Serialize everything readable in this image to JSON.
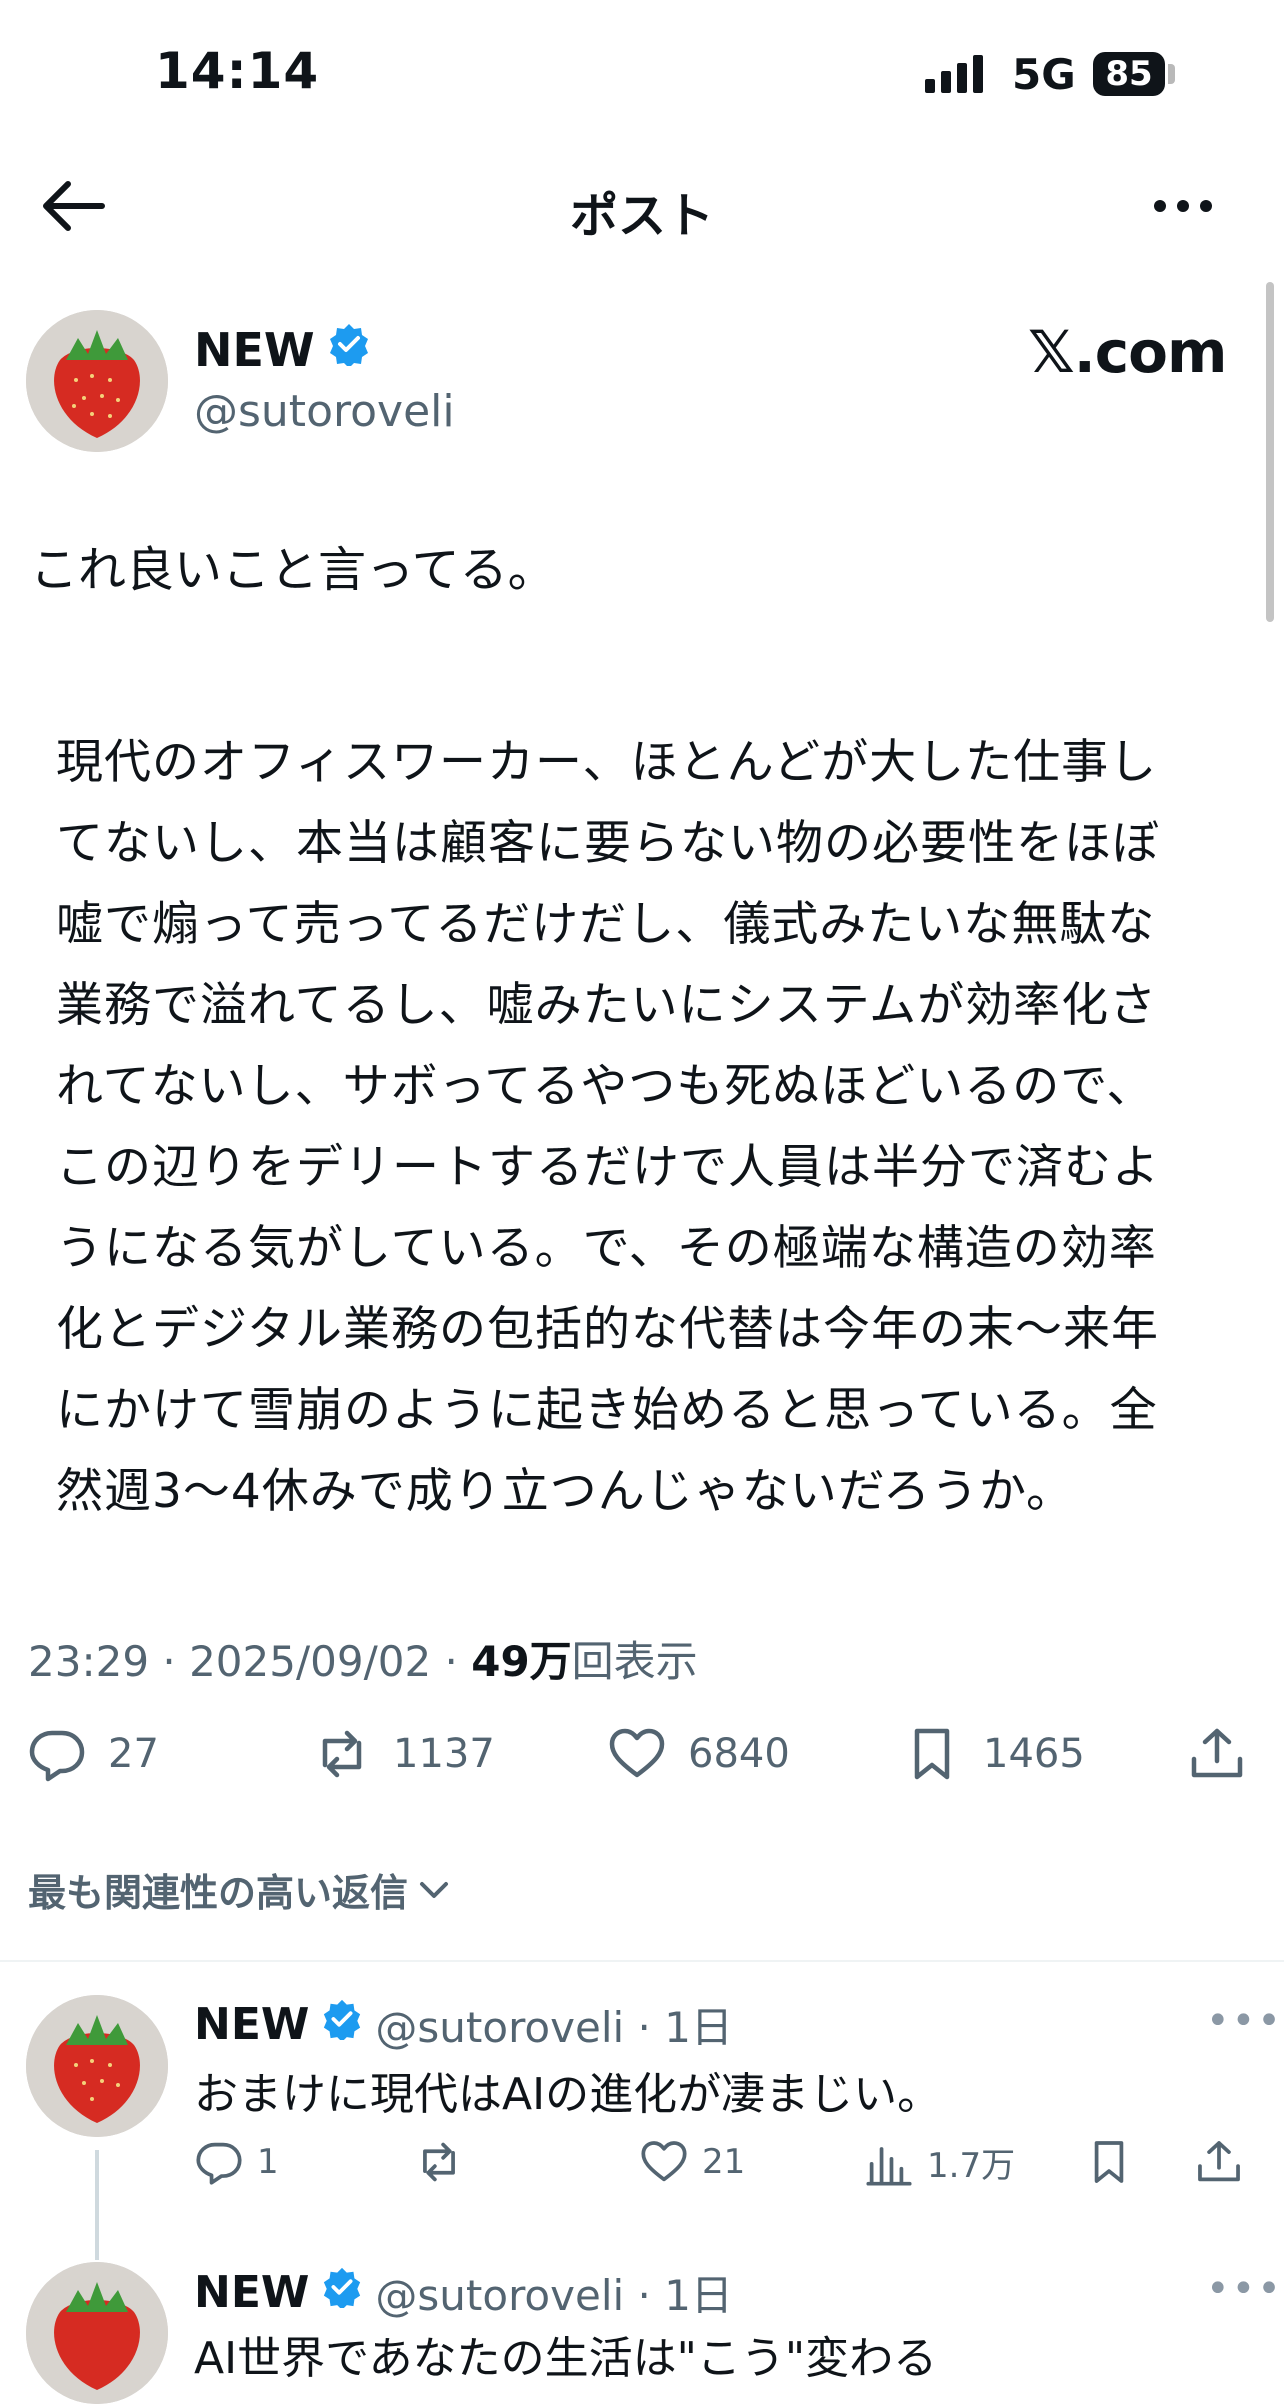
{
  "status_bar": {
    "time": "14:14",
    "network": "5G",
    "battery": "85"
  },
  "header": {
    "title": "ポスト"
  },
  "post": {
    "author_name": "NEW",
    "author_handle": "@sutoroveli",
    "source_badge": "𝕏.com",
    "intro_text": "これ良いこと言ってる。",
    "quote_lines": [
      "現代のオフィスワーカー、ほとんどが大した仕事し",
      "てないし、本当は顧客に要らない物の必要性をほぼ",
      "嘘で煽って売ってるだけだし、儀式みたいな無駄な",
      "業務で溢れてるし、嘘みたいにシステムが効率化さ",
      "れてないし、サボってるやつも死ぬほどいるので、",
      "この辺りをデリートするだけで人員は半分で済むよ",
      "うになる気がしている。で、その極端な構造の効率",
      "化とデジタル業務の包括的な代替は今年の末〜来年",
      "にかけて雪崩のように起き始めると思っている。全",
      "然週3〜4休みで成り立つんじゃないだろうか。"
    ],
    "time": "23:29 · 2025/09/02 · ",
    "views_count": "49万",
    "views_label": "回表示",
    "replies": "27",
    "reposts": "1137",
    "likes": "6840",
    "bookmarks": "1465"
  },
  "replies_sort_label": "最も関連性の高い返信",
  "replies": [
    {
      "name": "NEW",
      "handle_time": "@sutoroveli · 1日",
      "text": "おまけに現代はAIの進化が凄まじい。",
      "replies": "1",
      "reposts": "",
      "likes": "21",
      "views": "1.7万"
    },
    {
      "name": "NEW",
      "handle_time": "@sutoroveli · 1日",
      "text": "AI世界であなたの生活は\"こう\"変わる"
    }
  ],
  "icons": [
    "back-arrow-icon",
    "more-icon",
    "verified-badge-icon",
    "reply-icon",
    "repost-icon",
    "like-icon",
    "bookmark-icon",
    "share-icon",
    "views-icon",
    "chevron-down-icon"
  ],
  "colors": {
    "verified": "#1d9bf0",
    "secondary_text": "#536471",
    "primary_text": "#0f1419"
  }
}
